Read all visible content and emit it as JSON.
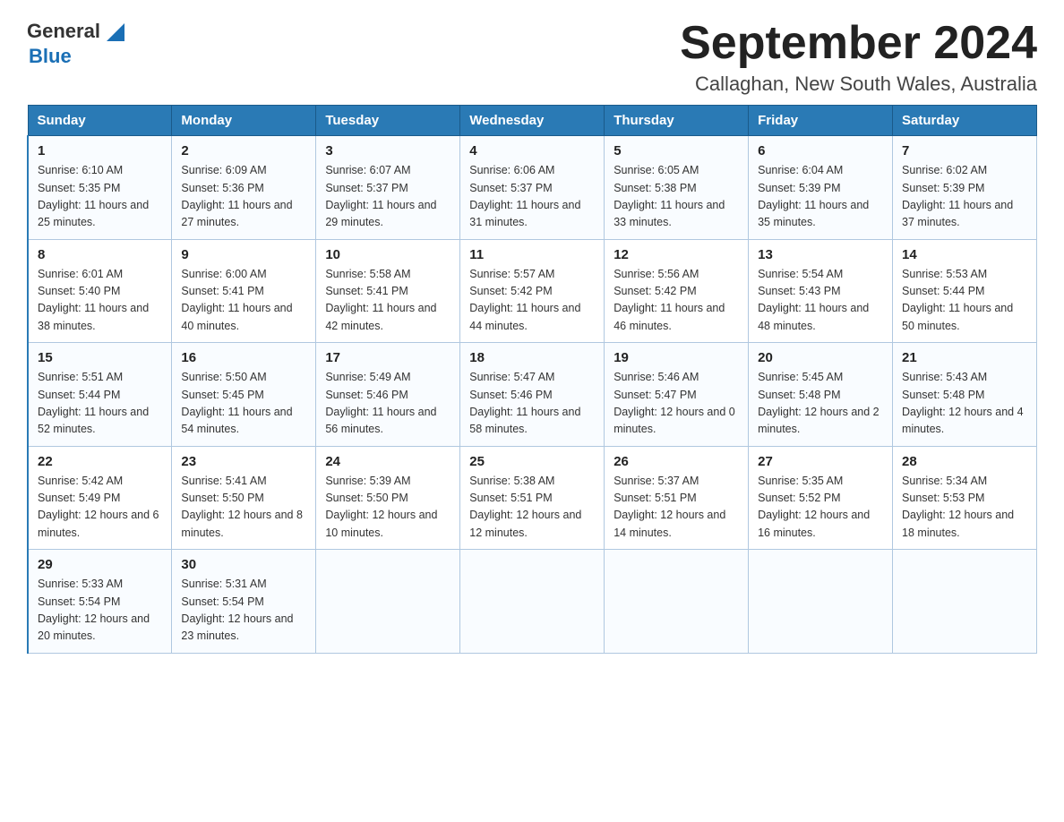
{
  "header": {
    "logo": {
      "text1": "General",
      "text2": "Blue"
    },
    "title": "September 2024",
    "location": "Callaghan, New South Wales, Australia"
  },
  "weekdays": [
    "Sunday",
    "Monday",
    "Tuesday",
    "Wednesday",
    "Thursday",
    "Friday",
    "Saturday"
  ],
  "weeks": [
    [
      {
        "day": "1",
        "sunrise": "6:10 AM",
        "sunset": "5:35 PM",
        "daylight": "11 hours and 25 minutes."
      },
      {
        "day": "2",
        "sunrise": "6:09 AM",
        "sunset": "5:36 PM",
        "daylight": "11 hours and 27 minutes."
      },
      {
        "day": "3",
        "sunrise": "6:07 AM",
        "sunset": "5:37 PM",
        "daylight": "11 hours and 29 minutes."
      },
      {
        "day": "4",
        "sunrise": "6:06 AM",
        "sunset": "5:37 PM",
        "daylight": "11 hours and 31 minutes."
      },
      {
        "day": "5",
        "sunrise": "6:05 AM",
        "sunset": "5:38 PM",
        "daylight": "11 hours and 33 minutes."
      },
      {
        "day": "6",
        "sunrise": "6:04 AM",
        "sunset": "5:39 PM",
        "daylight": "11 hours and 35 minutes."
      },
      {
        "day": "7",
        "sunrise": "6:02 AM",
        "sunset": "5:39 PM",
        "daylight": "11 hours and 37 minutes."
      }
    ],
    [
      {
        "day": "8",
        "sunrise": "6:01 AM",
        "sunset": "5:40 PM",
        "daylight": "11 hours and 38 minutes."
      },
      {
        "day": "9",
        "sunrise": "6:00 AM",
        "sunset": "5:41 PM",
        "daylight": "11 hours and 40 minutes."
      },
      {
        "day": "10",
        "sunrise": "5:58 AM",
        "sunset": "5:41 PM",
        "daylight": "11 hours and 42 minutes."
      },
      {
        "day": "11",
        "sunrise": "5:57 AM",
        "sunset": "5:42 PM",
        "daylight": "11 hours and 44 minutes."
      },
      {
        "day": "12",
        "sunrise": "5:56 AM",
        "sunset": "5:42 PM",
        "daylight": "11 hours and 46 minutes."
      },
      {
        "day": "13",
        "sunrise": "5:54 AM",
        "sunset": "5:43 PM",
        "daylight": "11 hours and 48 minutes."
      },
      {
        "day": "14",
        "sunrise": "5:53 AM",
        "sunset": "5:44 PM",
        "daylight": "11 hours and 50 minutes."
      }
    ],
    [
      {
        "day": "15",
        "sunrise": "5:51 AM",
        "sunset": "5:44 PM",
        "daylight": "11 hours and 52 minutes."
      },
      {
        "day": "16",
        "sunrise": "5:50 AM",
        "sunset": "5:45 PM",
        "daylight": "11 hours and 54 minutes."
      },
      {
        "day": "17",
        "sunrise": "5:49 AM",
        "sunset": "5:46 PM",
        "daylight": "11 hours and 56 minutes."
      },
      {
        "day": "18",
        "sunrise": "5:47 AM",
        "sunset": "5:46 PM",
        "daylight": "11 hours and 58 minutes."
      },
      {
        "day": "19",
        "sunrise": "5:46 AM",
        "sunset": "5:47 PM",
        "daylight": "12 hours and 0 minutes."
      },
      {
        "day": "20",
        "sunrise": "5:45 AM",
        "sunset": "5:48 PM",
        "daylight": "12 hours and 2 minutes."
      },
      {
        "day": "21",
        "sunrise": "5:43 AM",
        "sunset": "5:48 PM",
        "daylight": "12 hours and 4 minutes."
      }
    ],
    [
      {
        "day": "22",
        "sunrise": "5:42 AM",
        "sunset": "5:49 PM",
        "daylight": "12 hours and 6 minutes."
      },
      {
        "day": "23",
        "sunrise": "5:41 AM",
        "sunset": "5:50 PM",
        "daylight": "12 hours and 8 minutes."
      },
      {
        "day": "24",
        "sunrise": "5:39 AM",
        "sunset": "5:50 PM",
        "daylight": "12 hours and 10 minutes."
      },
      {
        "day": "25",
        "sunrise": "5:38 AM",
        "sunset": "5:51 PM",
        "daylight": "12 hours and 12 minutes."
      },
      {
        "day": "26",
        "sunrise": "5:37 AM",
        "sunset": "5:51 PM",
        "daylight": "12 hours and 14 minutes."
      },
      {
        "day": "27",
        "sunrise": "5:35 AM",
        "sunset": "5:52 PM",
        "daylight": "12 hours and 16 minutes."
      },
      {
        "day": "28",
        "sunrise": "5:34 AM",
        "sunset": "5:53 PM",
        "daylight": "12 hours and 18 minutes."
      }
    ],
    [
      {
        "day": "29",
        "sunrise": "5:33 AM",
        "sunset": "5:54 PM",
        "daylight": "12 hours and 20 minutes."
      },
      {
        "day": "30",
        "sunrise": "5:31 AM",
        "sunset": "5:54 PM",
        "daylight": "12 hours and 23 minutes."
      },
      null,
      null,
      null,
      null,
      null
    ]
  ],
  "labels": {
    "sunrise": "Sunrise:",
    "sunset": "Sunset:",
    "daylight": "Daylight:"
  }
}
